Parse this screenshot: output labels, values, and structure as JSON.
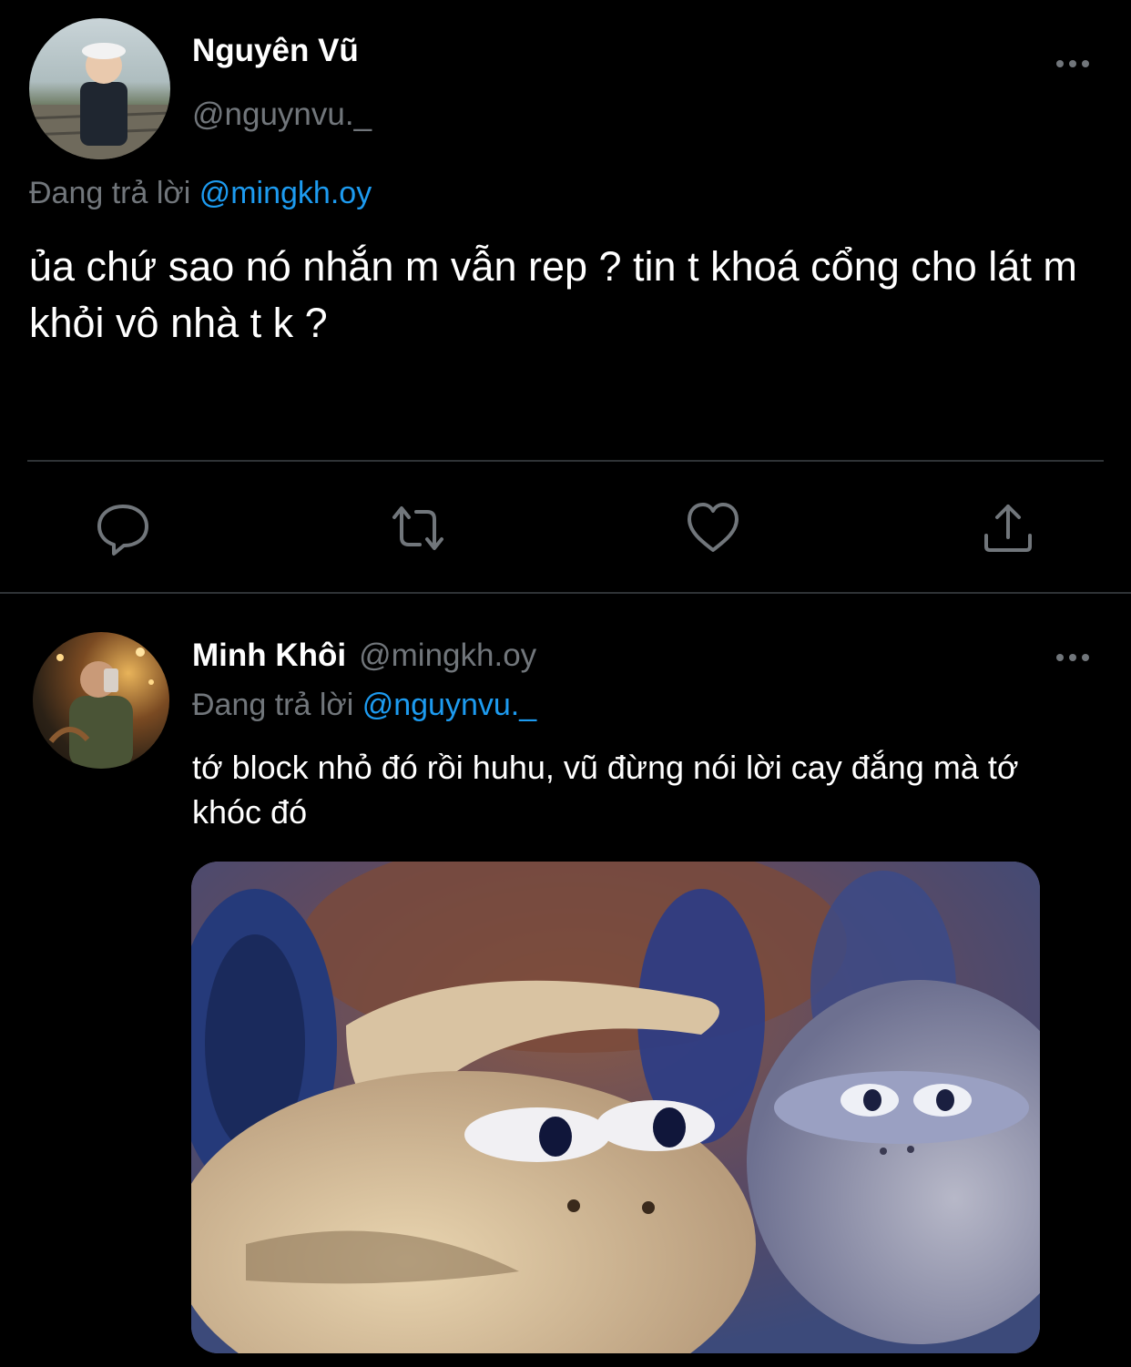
{
  "tweet1": {
    "display_name": "Nguyên Vũ",
    "handle": "@nguynvu._",
    "more_icon": "ellipsis-icon",
    "reply_prefix": "Đang trả lời",
    "reply_mention": "@mingkh.oy",
    "text": "ủa chứ sao nó nhắn m vẫn rep ? tin t khoá cổng cho lát m khỏi vô nhà t k ?",
    "actions": [
      "reply-icon",
      "retweet-icon",
      "like-icon",
      "share-icon"
    ]
  },
  "tweet2": {
    "display_name": "Minh Khôi",
    "handle": "@mingkh.oy",
    "more_icon": "ellipsis-icon",
    "reply_prefix": "Đang trả lời",
    "reply_mention": "@nguynvu._",
    "text": "tớ block nhỏ đó rồi huhu, vũ đừng nói lời cay đắng mà tớ khóc đó"
  },
  "colors": {
    "background": "#000000",
    "text": "#ffffff",
    "secondary": "#71767b",
    "accent": "#1d9bf0",
    "divider": "#2f3336"
  }
}
